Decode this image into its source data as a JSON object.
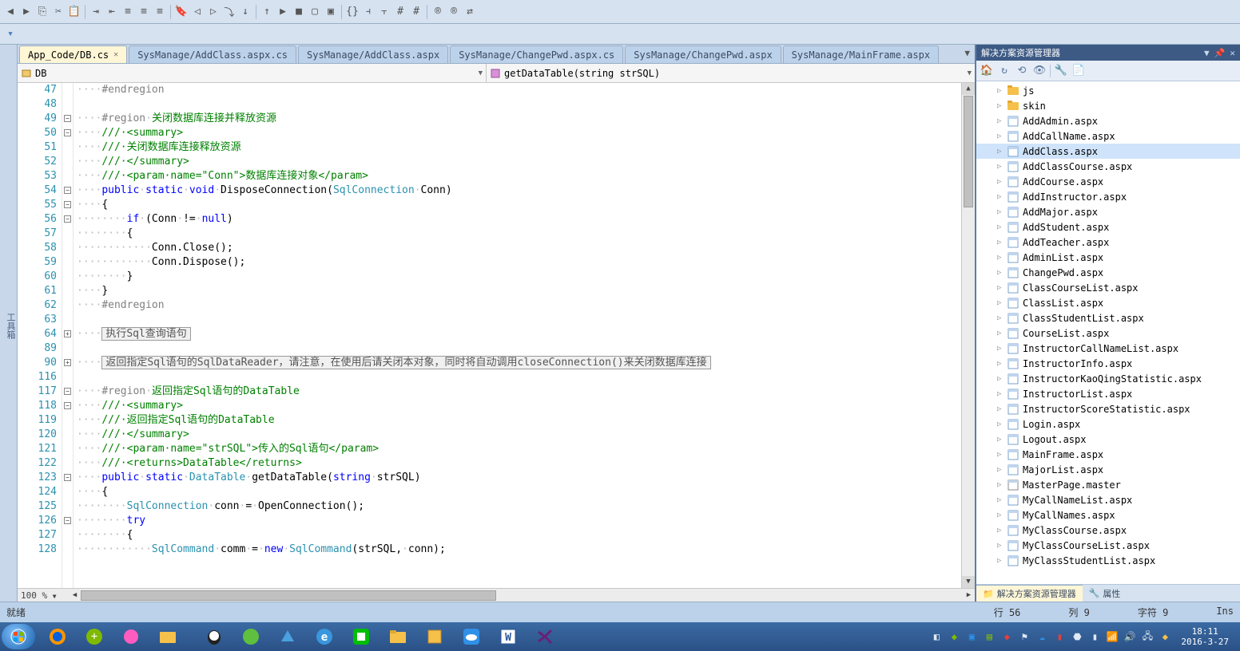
{
  "toolbar1_icons": [
    "nav-back",
    "nav-fwd",
    "copy",
    "cut",
    "paste",
    "indent",
    "outdent",
    "align-l",
    "align-c",
    "align-r",
    "bookmark",
    "bookmark-prev",
    "bookmark-next",
    "debug-step",
    "debug-into",
    "debug-out",
    "play",
    "stop",
    "square",
    "box",
    "code-block",
    "split",
    "split-h",
    "hex",
    "hex2",
    "reg",
    "reg2",
    "toggle"
  ],
  "toolbar2_label": "",
  "tabs": [
    {
      "label": "App_Code/DB.cs",
      "active": true,
      "closeable": true
    },
    {
      "label": "SysManage/AddClass.aspx.cs",
      "active": false
    },
    {
      "label": "SysManage/AddClass.aspx",
      "active": false
    },
    {
      "label": "SysManage/ChangePwd.aspx.cs",
      "active": false
    },
    {
      "label": "SysManage/ChangePwd.aspx",
      "active": false
    },
    {
      "label": "SysManage/MainFrame.aspx",
      "active": false
    }
  ],
  "crumb_left": "DB",
  "crumb_right": "getDataTable(string strSQL)",
  "lines": [
    {
      "n": 47,
      "html": "<span class='dots'>····</span><span class='reg'>#endregion</span>"
    },
    {
      "n": 48,
      "html": ""
    },
    {
      "n": 49,
      "html": "<span class='dots'>····</span><span class='reg'>#region</span><span class='dots'>·</span><span class='cmt'>关闭数据库连接并释放资源</span>",
      "fold": "-"
    },
    {
      "n": 50,
      "html": "<span class='dots'>····</span><span class='cmt'>///·&lt;summary&gt;</span>",
      "fold": "-"
    },
    {
      "n": 51,
      "html": "<span class='dots'>····</span><span class='cmt'>///·关闭数据库连接释放资源</span>"
    },
    {
      "n": 52,
      "html": "<span class='dots'>····</span><span class='cmt'>///·&lt;/summary&gt;</span>"
    },
    {
      "n": 53,
      "html": "<span class='dots'>····</span><span class='cmt'>///·&lt;param·name=\"Conn\"&gt;</span><span class='cmt'>数据库连接对象</span><span class='cmt'>&lt;/param&gt;</span>"
    },
    {
      "n": 54,
      "html": "<span class='dots'>····</span><span class='kw'>public</span><span class='dots'>·</span><span class='kw'>static</span><span class='dots'>·</span><span class='kw'>void</span><span class='dots'>·</span>DisposeConnection(<span class='type'>SqlConnection</span><span class='dots'>·</span>Conn)",
      "fold": "-"
    },
    {
      "n": 55,
      "html": "<span class='dots'>····</span>{",
      "arrow": true,
      "fold": "-"
    },
    {
      "n": 56,
      "html": "<span class='dots'>········</span><span class='kw'>if</span><span class='dots'>·</span>(Conn<span class='dots'>·</span>!=<span class='dots'>·</span><span class='kw'>null</span>)",
      "fold": "-"
    },
    {
      "n": 57,
      "html": "<span class='dots'>········</span>{"
    },
    {
      "n": 58,
      "html": "<span class='dots'>············</span>Conn.Close();"
    },
    {
      "n": 59,
      "html": "<span class='dots'>············</span>Conn.Dispose();"
    },
    {
      "n": 60,
      "html": "<span class='dots'>········</span>}"
    },
    {
      "n": 61,
      "html": "<span class='dots'>····</span>}"
    },
    {
      "n": 62,
      "html": "<span class='dots'>····</span><span class='reg'>#endregion</span>"
    },
    {
      "n": 63,
      "html": ""
    },
    {
      "n": 64,
      "html": "<span class='dots'>····</span><span class='collapsed'>执行Sql查询语句</span>",
      "fold": "+"
    },
    {
      "n": 89,
      "html": ""
    },
    {
      "n": 90,
      "html": "<span class='dots'>····</span><span class='collapsed'>返回指定Sql语句的SqlDataReader，请注意，在使用后请关闭本对象，同时将自动调用closeConnection()来关闭数据库连接</span>",
      "fold": "+"
    },
    {
      "n": 116,
      "html": ""
    },
    {
      "n": 117,
      "html": "<span class='dots'>····</span><span class='reg'>#region</span><span class='dots'>·</span><span class='cmt'>返回指定Sql语句的DataTable</span>",
      "fold": "-"
    },
    {
      "n": 118,
      "html": "<span class='dots'>····</span><span class='cmt'>///·&lt;summary&gt;</span>",
      "fold": "-"
    },
    {
      "n": 119,
      "html": "<span class='dots'>····</span><span class='cmt'>///·返回指定Sql语句的DataTable</span>"
    },
    {
      "n": 120,
      "html": "<span class='dots'>····</span><span class='cmt'>///·&lt;/summary&gt;</span>"
    },
    {
      "n": 121,
      "html": "<span class='dots'>····</span><span class='cmt'>///·&lt;param·name=\"strSQL\"&gt;传入的Sql语句&lt;/param&gt;</span>"
    },
    {
      "n": 122,
      "html": "<span class='dots'>····</span><span class='cmt'>///·&lt;returns&gt;DataTable&lt;/returns&gt;</span>"
    },
    {
      "n": 123,
      "html": "<span class='dots'>····</span><span class='kw'>public</span><span class='dots'>·</span><span class='kw'>static</span><span class='dots'>·</span><span class='type'>DataTable</span><span class='dots'>·</span>getDataTable(<span class='kw'>string</span><span class='dots'>·</span>strSQL)",
      "fold": "-"
    },
    {
      "n": 124,
      "html": "<span class='dots'>····</span>{"
    },
    {
      "n": 125,
      "html": "<span class='dots'>········</span><span class='type'>SqlConnection</span><span class='dots'>·</span>conn<span class='dots'>·</span>=<span class='dots'>·</span>OpenConnection();"
    },
    {
      "n": 126,
      "html": "<span class='dots'>········</span><span class='kw'>try</span>",
      "fold": "-"
    },
    {
      "n": 127,
      "html": "<span class='dots'>········</span>{"
    },
    {
      "n": 128,
      "html": "<span class='dots'>············</span><span class='type'>SqlCommand</span><span class='dots'>·</span>comm<span class='dots'>·</span>=<span class='dots'>·</span><span class='kw'>new</span><span class='dots'>·</span><span class='type'>SqlCommand</span>(strSQL,<span class='dots'>·</span>conn);"
    }
  ],
  "zoom": "100 %",
  "solution_title": "解决方案资源管理器",
  "tree": [
    {
      "t": "folder",
      "name": "js",
      "d": 1
    },
    {
      "t": "folder",
      "name": "skin",
      "d": 1
    },
    {
      "t": "aspx",
      "name": "AddAdmin.aspx",
      "d": 1
    },
    {
      "t": "aspx",
      "name": "AddCallName.aspx",
      "d": 1
    },
    {
      "t": "aspx",
      "name": "AddClass.aspx",
      "d": 1,
      "sel": true
    },
    {
      "t": "aspx",
      "name": "AddClassCourse.aspx",
      "d": 1
    },
    {
      "t": "aspx",
      "name": "AddCourse.aspx",
      "d": 1
    },
    {
      "t": "aspx",
      "name": "AddInstructor.aspx",
      "d": 1
    },
    {
      "t": "aspx",
      "name": "AddMajor.aspx",
      "d": 1
    },
    {
      "t": "aspx",
      "name": "AddStudent.aspx",
      "d": 1
    },
    {
      "t": "aspx",
      "name": "AddTeacher.aspx",
      "d": 1
    },
    {
      "t": "aspx",
      "name": "AdminList.aspx",
      "d": 1
    },
    {
      "t": "aspx",
      "name": "ChangePwd.aspx",
      "d": 1
    },
    {
      "t": "aspx",
      "name": "ClassCourseList.aspx",
      "d": 1
    },
    {
      "t": "aspx",
      "name": "ClassList.aspx",
      "d": 1
    },
    {
      "t": "aspx",
      "name": "ClassStudentList.aspx",
      "d": 1
    },
    {
      "t": "aspx",
      "name": "CourseList.aspx",
      "d": 1
    },
    {
      "t": "aspx",
      "name": "InstructorCallNameList.aspx",
      "d": 1
    },
    {
      "t": "aspx",
      "name": "InstructorInfo.aspx",
      "d": 1
    },
    {
      "t": "aspx",
      "name": "InstructorKaoQingStatistic.aspx",
      "d": 1
    },
    {
      "t": "aspx",
      "name": "InstructorList.aspx",
      "d": 1
    },
    {
      "t": "aspx",
      "name": "InstructorScoreStatistic.aspx",
      "d": 1
    },
    {
      "t": "aspx",
      "name": "Login.aspx",
      "d": 1
    },
    {
      "t": "aspx",
      "name": "Logout.aspx",
      "d": 1
    },
    {
      "t": "aspx",
      "name": "MainFrame.aspx",
      "d": 1
    },
    {
      "t": "aspx",
      "name": "MajorList.aspx",
      "d": 1
    },
    {
      "t": "master",
      "name": "MasterPage.master",
      "d": 1
    },
    {
      "t": "aspx",
      "name": "MyCallNameList.aspx",
      "d": 1
    },
    {
      "t": "aspx",
      "name": "MyCallNames.aspx",
      "d": 1
    },
    {
      "t": "aspx",
      "name": "MyClassCourse.aspx",
      "d": 1
    },
    {
      "t": "aspx",
      "name": "MyClassCourseList.aspx",
      "d": 1
    },
    {
      "t": "aspx",
      "name": "MyClassStudentList.aspx",
      "d": 1
    }
  ],
  "panel_tabs": [
    {
      "label": "解决方案资源管理器",
      "active": true,
      "icon": "📁"
    },
    {
      "label": "属性",
      "active": false,
      "icon": "🔧"
    }
  ],
  "status_left": "就绪",
  "status": {
    "line": "行 56",
    "col": "列 9",
    "char": "字符 9",
    "ins": "Ins"
  },
  "side_label": "工具箱",
  "clock": {
    "time": "18:11",
    "date": "2016-3-27"
  }
}
